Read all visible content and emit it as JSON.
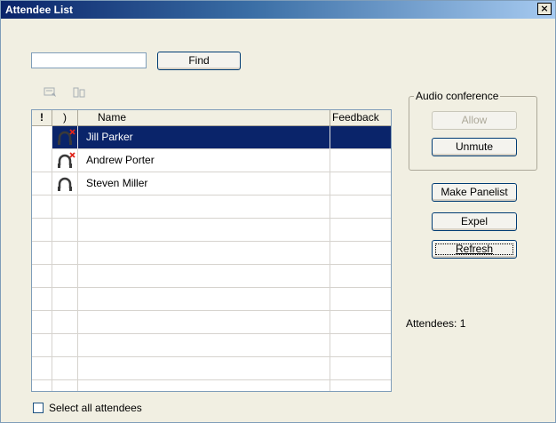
{
  "window": {
    "title": "Attendee List",
    "close_label": "×"
  },
  "search": {
    "value": "",
    "find_label": "Find"
  },
  "toolbar": {
    "icons": [
      "chat-icon",
      "transfer-icon"
    ]
  },
  "table": {
    "columns": [
      "!",
      ")",
      "Name",
      "Feedback"
    ],
    "rows": [
      {
        "status": "",
        "audio_icon": "headset-muted-icon",
        "name": "Jill Parker",
        "feedback": "",
        "selected": true
      },
      {
        "status": "",
        "audio_icon": "headset-muted-icon",
        "name": "Andrew Porter",
        "feedback": "",
        "selected": false
      },
      {
        "status": "",
        "audio_icon": "headset-icon",
        "name": "Steven Miller",
        "feedback": "",
        "selected": false
      }
    ],
    "empty_rows": 8
  },
  "audio_conference": {
    "legend": "Audio conference",
    "allow_label": "Allow",
    "unmute_label": "Unmute"
  },
  "actions": {
    "make_panelist_label": "Make Panelist",
    "expel_label": "Expel",
    "refresh_label": "Refresh"
  },
  "attendees_count": "Attendees: 1",
  "select_all": {
    "label": "Select all attendees",
    "checked": false
  },
  "colors": {
    "selection": "#0a246a",
    "mute_x": "#e0251b"
  }
}
